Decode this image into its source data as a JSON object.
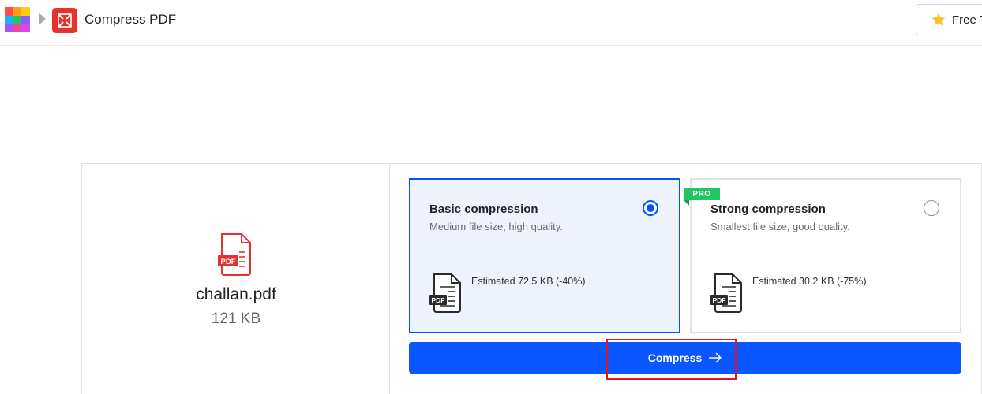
{
  "header": {
    "title": "Compress PDF",
    "free_trial_label": "Free T",
    "apps_grid_colors": [
      "#ff4b4b",
      "#ff9f1a",
      "#ffcc1a",
      "#1ab0ff",
      "#22c55e",
      "#8b5cf6",
      "#a855f7",
      "#ec4899",
      "#d946ef"
    ],
    "brand_color": "#e5322d"
  },
  "file": {
    "badge": "PDF",
    "name": "challan.pdf",
    "size": "121 KB"
  },
  "options": [
    {
      "title": "Basic compression",
      "description": "Medium file size, high quality.",
      "estimate": "Estimated 72.5 KB (-40%)",
      "selected": true
    },
    {
      "title": "Strong compression",
      "description": "Smallest file size, good quality.",
      "estimate": "Estimated 30.2 KB (-75%)",
      "selected": false,
      "badge": "PRO"
    }
  ],
  "doc_badge": "PDF",
  "compress_button": {
    "label": "Compress",
    "color": "#0a56ff"
  },
  "accent_color": "#0055ff",
  "pro_color": "#23c464",
  "highlight_color": "#e0171c"
}
